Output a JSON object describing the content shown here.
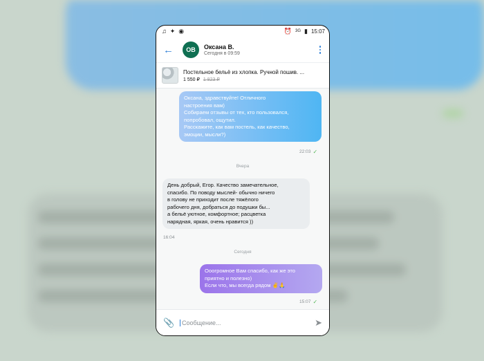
{
  "statusbar": {
    "left_icons": [
      "music-icon",
      "sparkle-icon",
      "media-icon"
    ],
    "right_icons": [
      "alarm-icon",
      "signal-icon",
      "battery-icon"
    ],
    "signal_text": "3G",
    "time": "15:07"
  },
  "header": {
    "avatar_initials": "ОВ",
    "name": "Оксана В.",
    "last_seen": "Сегодня в 09:59"
  },
  "product": {
    "title": "Постельное бельё из хлопка. Ручной пошив. ...",
    "price": "1 550 ₽",
    "old_price": "1 823 ₽"
  },
  "messages": {
    "out1": {
      "lines": [
        "Оксана, здравствуйте! Отличного",
        "настроения вам)",
        "Собираем отзывы от тех, кто пользовался,",
        "попробовал, ощутил.",
        "Расскажите, как вам постель, как качество,",
        "эмоции, мысли?)"
      ],
      "time": "22:03"
    },
    "sep_yesterday": "Вчера",
    "in1": {
      "lines": [
        "День добрый, Егор. Качество замечательное,",
        "спасибо. По поводу мыслей- обычно ничего",
        "в голову не приходит после тяжёлого",
        "рабочего дня, добраться до подушки бы...",
        "а бельё уютное, комфортное; расцветка",
        "нарядная, яркая, очень нравится ))"
      ],
      "time": "16:04"
    },
    "sep_today": "Сегодня",
    "out2": {
      "lines": [
        "Ооогромное Вам спасибо, как же это",
        "приятно и полезно)",
        "Если что, мы всегда рядом ✌️🙏"
      ],
      "time": "15:07"
    }
  },
  "composer": {
    "placeholder": "Сообщение..."
  }
}
